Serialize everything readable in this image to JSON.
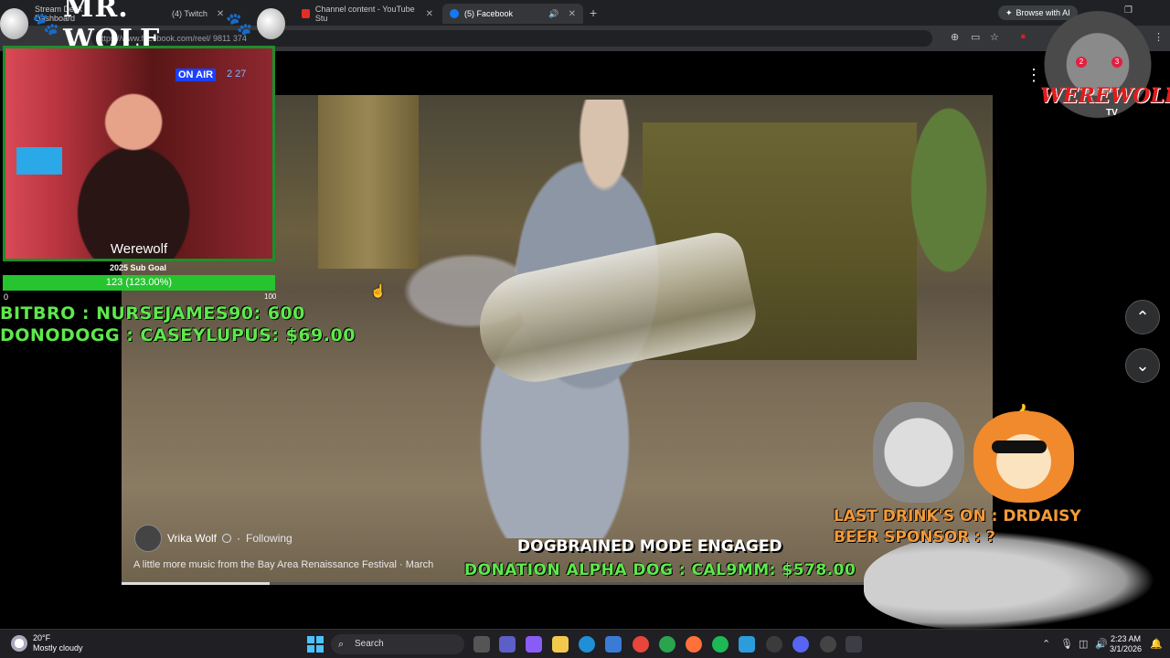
{
  "browser": {
    "tabs": [
      {
        "label": "Stream Deck Dashboard",
        "active": false
      },
      {
        "label": "(4) Twitch",
        "active": false
      },
      {
        "label": "Channel content - YouTube Stu",
        "active": false
      },
      {
        "label": "(5) Facebook",
        "active": true
      }
    ],
    "browse_ai": "Browse with AI",
    "url": "https://www.facebook.com/reel/            9811             374"
  },
  "overlay": {
    "banner_title": "MR. WOLF",
    "cam_name": "Werewolf",
    "cam_sign": "ON AIR",
    "cam_clock": "2 27",
    "sub_goal": {
      "label": "2025 Sub Goal",
      "text": "123 (123.00%)",
      "min": "0",
      "max": "100",
      "progress": 1.0
    },
    "donations": [
      "BITBRO : NURSEJAMES90: 600",
      "DONODOGG : CASEYLUPUS: $69.00"
    ],
    "mode_text": "DOGBRAINED MODE ENGAGED",
    "alpha_dog": "DONATION ALPHA DOG : CAL9MM: $578.00",
    "last_drink": "LAST DRINK'S ON : DRDAISY",
    "beer_sponsor": "BEER SPONSOR : ?",
    "logo_text": "WEREWOLF",
    "logo_sub": "TV",
    "notif_counts": [
      "2",
      "3"
    ]
  },
  "reel": {
    "poster_name": "Vrika Wolf",
    "follow_state": "Following",
    "caption": "A little more music from the Bay Area Renaissance Festival · March"
  },
  "taskbar": {
    "weather_temp": "20°F",
    "weather_desc": "Mostly cloudy",
    "search_placeholder": "Search",
    "time": "2:23 AM",
    "date": "3/1/2026"
  },
  "colors": {
    "accent_green": "#5ee84c",
    "accent_orange": "#f39a3a",
    "facebook_blue": "#1877f2"
  }
}
